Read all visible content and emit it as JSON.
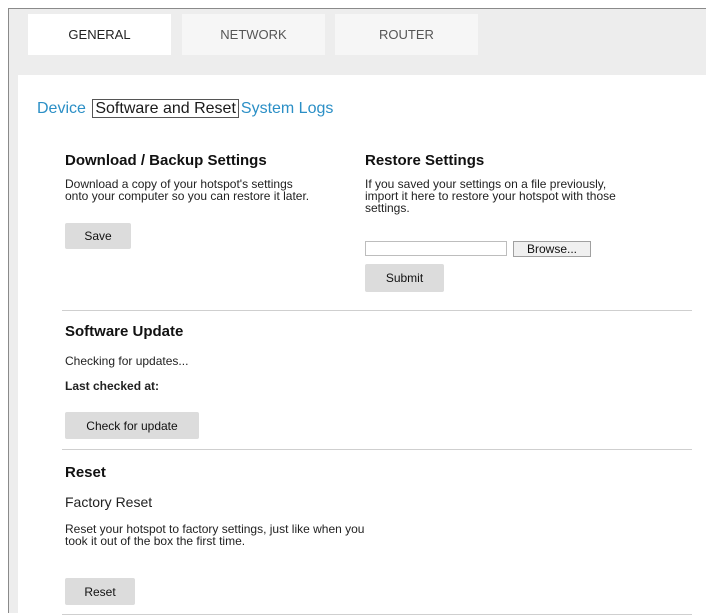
{
  "tabs": [
    {
      "label": "GENERAL",
      "active": true
    },
    {
      "label": "NETWORK",
      "active": false
    },
    {
      "label": "ROUTER",
      "active": false
    }
  ],
  "subnav": {
    "device": "Device",
    "software_reset": "Software and Reset",
    "system_logs": "System Logs"
  },
  "download": {
    "title": "Download / Backup Settings",
    "description": "Download a copy of your hotspot's settings onto your computer so you can restore it later.",
    "save_label": "Save"
  },
  "restore": {
    "title": "Restore Settings",
    "description": "If you saved your settings on a file previously, import it here to restore your hotspot with those settings.",
    "file_value": "",
    "browse_label": "Browse...",
    "submit_label": "Submit"
  },
  "software_update": {
    "title": "Software Update",
    "status": "Checking for updates...",
    "last_checked_label": "Last checked at:",
    "check_label": "Check for update"
  },
  "reset": {
    "title": "Reset",
    "subtitle": "Factory Reset",
    "description": "Reset your hotspot to factory settings, just like when you took it out of the box the first time.",
    "reset_label": "Reset"
  },
  "colors": {
    "link": "#2b8fc6",
    "frame_bg": "#ededed",
    "button_bg": "#dcdcdc"
  }
}
